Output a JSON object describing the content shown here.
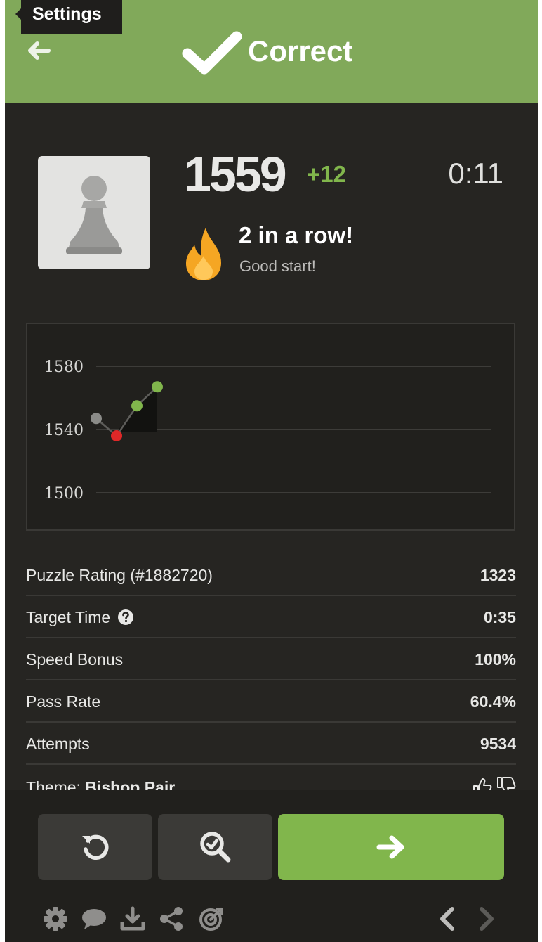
{
  "tooltip": {
    "text": "Settings"
  },
  "header": {
    "title": "Correct",
    "accent_color": "#81a95a"
  },
  "player": {
    "rating": "1559",
    "rating_delta": "+12",
    "timer": "0:11",
    "streak_title": "2 in a row!",
    "streak_subtitle": "Good start!"
  },
  "chart_data": {
    "type": "line",
    "y_ticks": [
      "1580",
      "1540",
      "1500"
    ],
    "ylim": [
      1500,
      1580
    ],
    "x": [
      1,
      2,
      3,
      4
    ],
    "values": [
      1547,
      1536,
      1555,
      1567
    ],
    "point_colors": [
      "#8b8b88",
      "#e02828",
      "#81b64c",
      "#81b64c"
    ],
    "grid": true
  },
  "stats": [
    {
      "label": "Puzzle Rating (#1882720)",
      "value": "1323",
      "has_help": false
    },
    {
      "label": "Target Time",
      "value": "0:35",
      "has_help": true
    },
    {
      "label": "Speed Bonus",
      "value": "100%",
      "has_help": false
    },
    {
      "label": "Pass Rate",
      "value": "60.4%",
      "has_help": false
    },
    {
      "label": "Attempts",
      "value": "9534",
      "has_help": false
    }
  ],
  "theme": {
    "prefix": "Theme: ",
    "name": "Bishop Pair"
  },
  "buttons": {
    "retry_icon": "retry-icon",
    "analyze_icon": "analysis-icon",
    "next_icon": "arrow-right-icon",
    "next_color": "#81b64c"
  },
  "toolbar": [
    "gear-icon",
    "chat-icon",
    "download-icon",
    "share-icon",
    "target-icon",
    "chevron-left-icon",
    "chevron-right-icon"
  ]
}
